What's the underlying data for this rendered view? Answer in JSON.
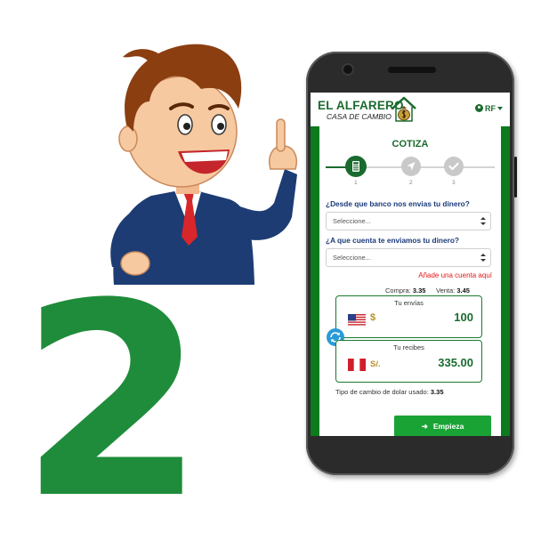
{
  "step_number": "2",
  "app": {
    "brand_title": "EL ALFARERO",
    "brand_subtitle": "CASA DE CAMBIO",
    "user_initials": "RF",
    "form_title": "COTIZA",
    "steps": [
      {
        "label": "1",
        "icon": "calculator-icon",
        "state": "active"
      },
      {
        "label": "2",
        "icon": "location-arrow-icon",
        "state": "inactive"
      },
      {
        "label": "3",
        "icon": "check-icon",
        "state": "inactive"
      }
    ],
    "question_source_bank": "¿Desde que banco nos envias tu dinero?",
    "source_bank_select": "Seleccione...",
    "question_target_account": "¿A que cuenta te enviamos tu dinero?",
    "target_account_select": "Seleccione...",
    "add_account_link": "Añade una cuenta aquí",
    "buy_label": "Compra:",
    "buy_rate": "3.35",
    "sell_label": "Venta:",
    "sell_rate": "3.45",
    "send_label": "Tu envías",
    "send_currency_symbol": "$",
    "send_amount": "100",
    "receive_label": "Tu recibes",
    "receive_currency_symbol": "S/.",
    "receive_amount": "335.00",
    "exchange_note_label": "Tipo de cambio de dolar usado:",
    "exchange_note_value": "3.35",
    "start_button": "Empieza"
  },
  "colors": {
    "brand_green": "#1a6b2e",
    "number_green": "#1e8c3a",
    "frame_green": "#0d7a1e",
    "button_green": "#1aa335",
    "alert_red": "#e11a1a",
    "swap_blue": "#2a9bd6"
  }
}
